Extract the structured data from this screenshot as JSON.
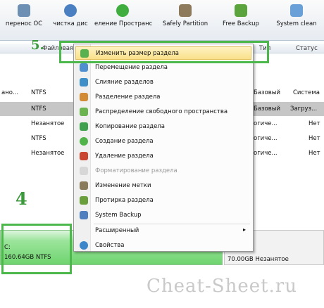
{
  "toolbar": {
    "buttons": [
      {
        "label": "перенос ОС",
        "icon": "download-icon"
      },
      {
        "label": "чистка дис",
        "icon": "wipe-icon"
      },
      {
        "label": "еление Пространс",
        "icon": "allocate-icon"
      },
      {
        "label": "Safely Partition",
        "icon": "safe-partition-icon"
      },
      {
        "label": "Free Backup",
        "icon": "backup-icon"
      },
      {
        "label": "System clean",
        "icon": "system-clean-icon"
      }
    ]
  },
  "columns": {
    "fs": "Файловая си",
    "type": "Тип",
    "status": "Статус"
  },
  "rows": [
    {
      "name": "ано...",
      "fs": "NTFS",
      "type": "Базовый",
      "status": "Система"
    },
    {
      "name": "",
      "fs": "NTFS",
      "type": "Базовый",
      "status": "Загруз..."
    },
    {
      "name": "",
      "fs": "Незанятое",
      "type": "огиче...",
      "status": "Нет"
    },
    {
      "name": "",
      "fs": "NTFS",
      "type": "огиче...",
      "status": "Нет"
    },
    {
      "name": "",
      "fs": "Незанятое",
      "type": "огиче...",
      "status": "Нет"
    }
  ],
  "annotations": {
    "step4": "4",
    "step5": "5."
  },
  "disk": {
    "drive_label": "C:",
    "drive_size": "160.64GB NTFS",
    "unallocated": "70.00GB Незанятое"
  },
  "watermark": "Cheat-Sheet.ru",
  "menu": {
    "items": [
      {
        "label": "Изменить размер раздела",
        "icon": "resize-icon",
        "state": "highlighted"
      },
      {
        "label": "Перемещение раздела",
        "icon": "move-icon",
        "state": "normal"
      },
      {
        "label": "Слияние разделов",
        "icon": "merge-icon",
        "state": "normal"
      },
      {
        "label": "Разделение раздела",
        "icon": "split-icon",
        "state": "normal"
      },
      {
        "label": "Распределение свободного пространства",
        "icon": "allocate-space-icon",
        "state": "normal"
      },
      {
        "label": "Копирование раздела",
        "icon": "copy-icon",
        "state": "normal"
      },
      {
        "label": "Создание раздела",
        "icon": "create-icon",
        "state": "normal"
      },
      {
        "label": "Удаление раздела",
        "icon": "delete-icon",
        "state": "normal"
      },
      {
        "label": "Форматирование раздела",
        "icon": "format-icon",
        "state": "disabled"
      },
      {
        "label": "Изменение метки",
        "icon": "label-icon",
        "state": "normal"
      },
      {
        "label": "Протирка раздела",
        "icon": "wipe-partition-icon",
        "state": "normal"
      },
      {
        "label": "System Backup",
        "icon": "backup-icon",
        "state": "normal"
      },
      {
        "label": "Расширенный",
        "icon": "",
        "state": "submenu"
      },
      {
        "label": "Свойства",
        "icon": "properties-icon",
        "state": "normal"
      }
    ]
  },
  "colors": {
    "annotation_green": "#4cb84c",
    "highlight": "#f9e08a",
    "disk_green": "#6fd46f"
  }
}
